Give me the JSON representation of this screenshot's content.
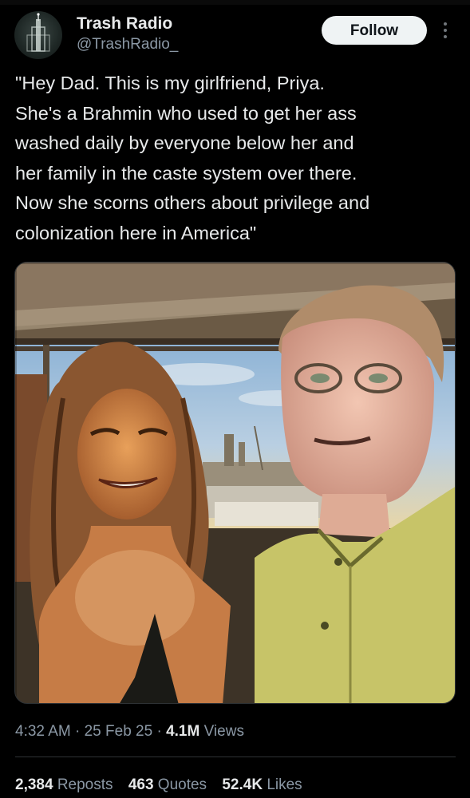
{
  "colors": {
    "background": "#000000",
    "primary_text": "#e7e9ea",
    "secondary_text": "#8b98a5",
    "follow_button_bg": "#eff3f4",
    "follow_button_text": "#0f1419",
    "divider": "#2f3336"
  },
  "author": {
    "display_name": "Trash Radio",
    "handle": "@TrashRadio_",
    "avatar_icon": "building-avatar-icon"
  },
  "header": {
    "follow_label": "Follow",
    "more_icon": "more-vertical-icon"
  },
  "tweet": {
    "text_lines": [
      "\"Hey Dad. This is my girlfriend, Priya.",
      "She's a Brahmin who used to get her ass",
      "washed daily by everyone below her and",
      "her family in the caste system over there.",
      "Now she scorns others about privilege and",
      "colonization here in America\""
    ]
  },
  "meta": {
    "time": "4:32 AM",
    "sep1": " · ",
    "date": "25 Feb 25",
    "sep2": " · ",
    "views_count": "4.1M",
    "views_label": " Views"
  },
  "stats": {
    "reposts_count": "2,384",
    "reposts_label": " Reposts",
    "quotes_count": "463",
    "quotes_label": " Quotes",
    "likes_count": "52.4K",
    "likes_label": " Likes"
  }
}
